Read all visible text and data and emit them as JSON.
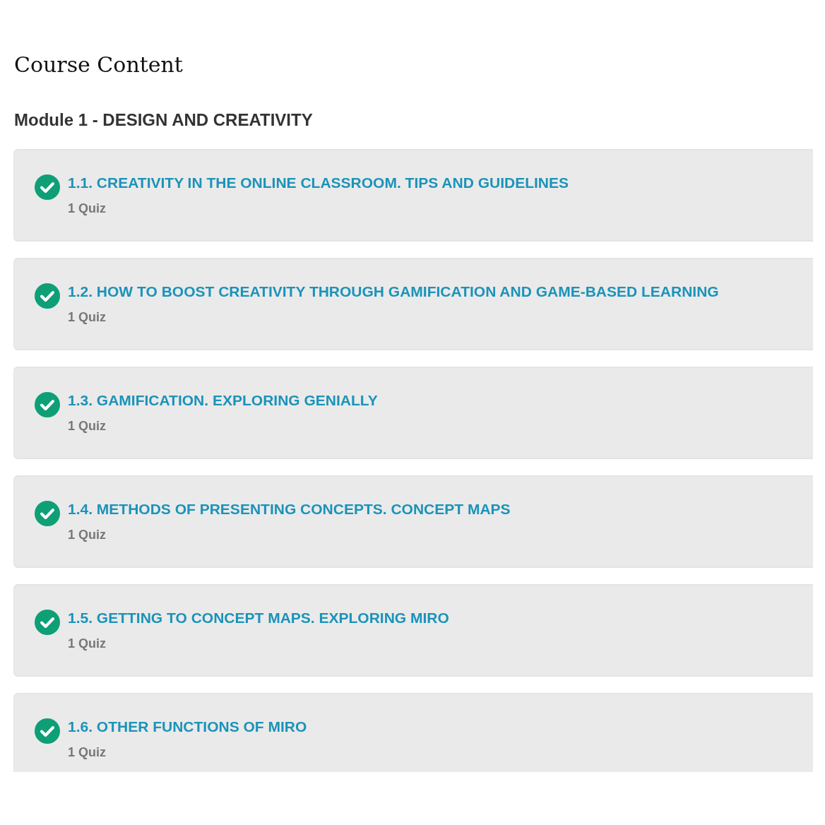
{
  "page_title": "Course Content",
  "module": {
    "title": "Module 1 - DESIGN AND CREATIVITY",
    "lessons": [
      {
        "title": "1.1. CREATIVITY IN THE ONLINE CLASSROOM. TIPS AND GUIDELINES",
        "meta": "1 Quiz",
        "completed": true
      },
      {
        "title": "1.2. HOW TO BOOST CREATIVITY THROUGH GAMIFICATION AND GAME-BASED LEARNING",
        "meta": "1 Quiz",
        "completed": true
      },
      {
        "title": "1.3. GAMIFICATION. EXPLORING GENIALLY",
        "meta": "1 Quiz",
        "completed": true
      },
      {
        "title": "1.4. METHODS OF PRESENTING CONCEPTS. CONCEPT MAPS",
        "meta": "1 Quiz",
        "completed": true
      },
      {
        "title": "1.5. GETTING TO CONCEPT MAPS. EXPLORING MIRO",
        "meta": "1 Quiz",
        "completed": true
      },
      {
        "title": "1.6. OTHER FUNCTIONS OF MIRO",
        "meta": "1 Quiz",
        "completed": true
      }
    ]
  }
}
